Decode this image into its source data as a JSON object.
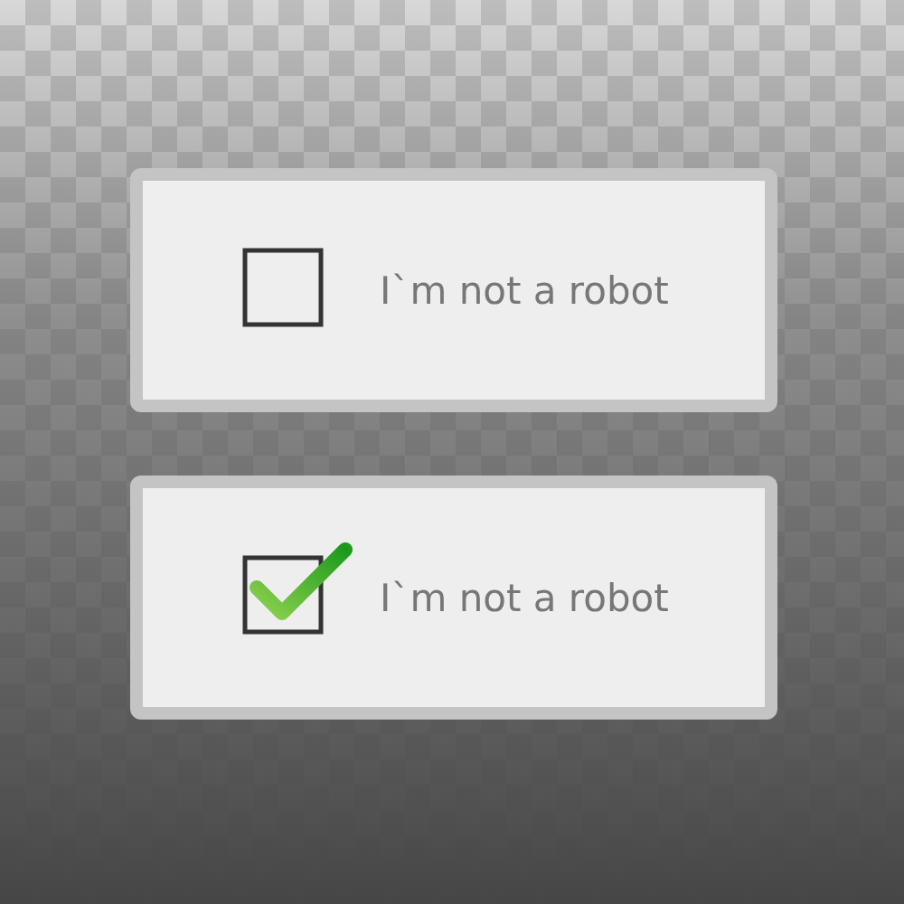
{
  "captchas": [
    {
      "label": "I`m not a robot",
      "checked": false
    },
    {
      "label": "I`m not a robot",
      "checked": true
    }
  ]
}
